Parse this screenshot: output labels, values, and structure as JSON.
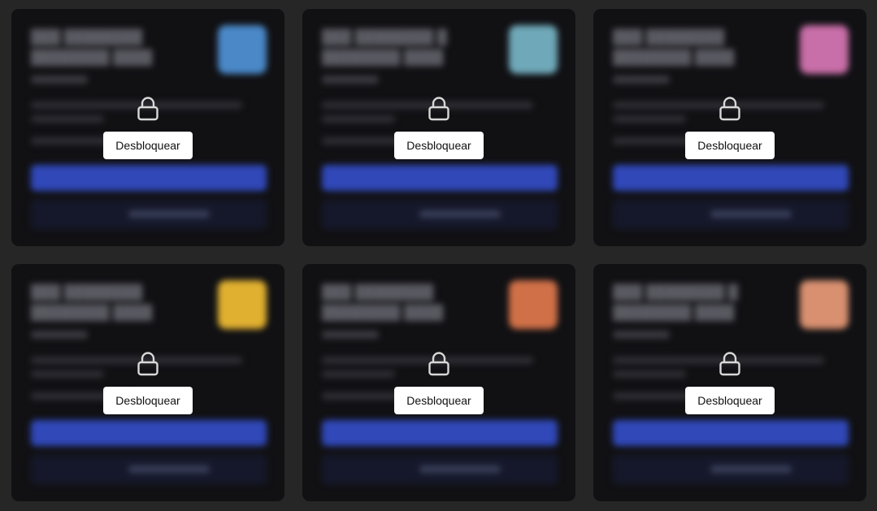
{
  "cards": [
    {
      "unlock_label": "Desbloquear",
      "thumb_color": "#4a88c8"
    },
    {
      "unlock_label": "Desbloquear",
      "thumb_color": "#6fa8b8"
    },
    {
      "unlock_label": "Desbloquear",
      "thumb_color": "#c86ea8"
    },
    {
      "unlock_label": "Desbloquear",
      "thumb_color": "#e0b030"
    },
    {
      "unlock_label": "Desbloquear",
      "thumb_color": "#d07048"
    },
    {
      "unlock_label": "Desbloquear",
      "thumb_color": "#d89070"
    }
  ],
  "icons": {
    "lock": "lock-icon"
  },
  "colors": {
    "background": "#262626",
    "card": "#111114",
    "primary": "#3048b8",
    "button": "#ffffff"
  }
}
